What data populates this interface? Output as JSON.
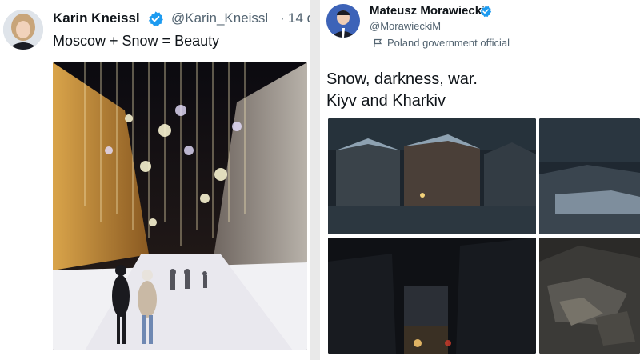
{
  "tweets": [
    {
      "author_name": "Karin Kneissl",
      "handle": "@Karin_Kneissl",
      "separator": "·",
      "time": "14 d",
      "text": "Moscow + Snow = Beauty",
      "verified": true
    },
    {
      "author_name": "Mateusz Morawiecki",
      "handle": "@MorawieckiM",
      "account_label": "Poland government official",
      "text_lines": [
        "Snow, darkness, war.",
        "Kiyv and Kharkiv"
      ],
      "verified": true
    }
  ],
  "colors": {
    "verified_blue": "#1d9bf0",
    "text_primary": "#0f1419",
    "text_secondary": "#536471"
  },
  "icons": {
    "verified": "verified-badge-icon",
    "government_label": "flag-icon"
  }
}
